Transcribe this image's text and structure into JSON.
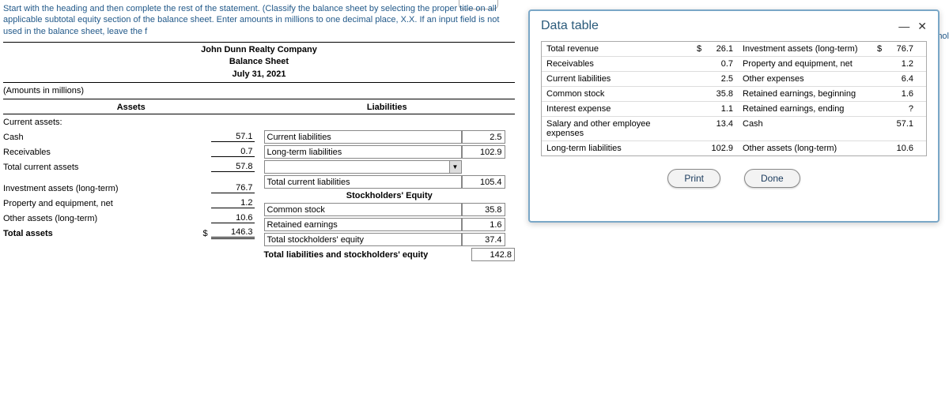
{
  "instructions": "Start with the heading and then complete the rest of the statement. (Classify the balance sheet by selecting the proper title on all applicable subtotal equity section of the balance sheet. Enter amounts in millions to one decimal place, X.X. If an input field is not used in the balance sheet, leave the f",
  "right_fragment": "tockhol",
  "header": {
    "company": "John Dunn Realty Company",
    "stmt": "Balance Sheet",
    "date": "July 31, 2021"
  },
  "amounts_note": "(Amounts in millions)",
  "col_headers": {
    "left": "Assets",
    "right": "Liabilities"
  },
  "assets": {
    "current_label": "Current assets:",
    "cash": {
      "label": "Cash",
      "amt": "57.1"
    },
    "recv": {
      "label": "Receivables",
      "amt": "0.7"
    },
    "tca": {
      "label": "Total current assets",
      "amt": "57.8"
    },
    "inv": {
      "label": "Investment assets (long-term)",
      "amt": "76.7"
    },
    "ppe": {
      "label": "Property and equipment, net",
      "amt": "1.2"
    },
    "other": {
      "label": "Other assets (long-term)",
      "amt": "10.6"
    },
    "total": {
      "label": "Total assets",
      "cur": "$",
      "amt": "146.3"
    }
  },
  "liab": {
    "cl": {
      "label": "Current liabilities",
      "amt": "2.5"
    },
    "lt": {
      "label": "Long-term liabilities",
      "amt": "102.9"
    },
    "blank": {
      "label": "",
      "amt": ""
    },
    "tcl": {
      "label": "Total current liabilities",
      "amt": "105.4"
    },
    "se_header": "Stockholders' Equity",
    "cs": {
      "label": "Common stock",
      "amt": "35.8"
    },
    "re": {
      "label": "Retained earnings",
      "amt": "1.6"
    },
    "tse": {
      "label": "Total stockholders' equity",
      "amt": "37.4"
    },
    "tlse": {
      "label": "Total liabilities and stockholders' equity",
      "amt": "142.8"
    }
  },
  "modal": {
    "title": "Data table",
    "rows": [
      {
        "l": "Total revenue",
        "lc": "$",
        "lv": "26.1",
        "r": "Investment assets (long-term)",
        "rc": "$",
        "rv": "76.7"
      },
      {
        "l": "Receivables",
        "lc": "",
        "lv": "0.7",
        "r": "Property and equipment, net",
        "rc": "",
        "rv": "1.2"
      },
      {
        "l": "Current liabilities",
        "lc": "",
        "lv": "2.5",
        "r": "Other expenses",
        "rc": "",
        "rv": "6.4"
      },
      {
        "l": "Common stock",
        "lc": "",
        "lv": "35.8",
        "r": "Retained earnings, beginning",
        "rc": "",
        "rv": "1.6"
      },
      {
        "l": "Interest expense",
        "lc": "",
        "lv": "1.1",
        "r": "Retained earnings, ending",
        "rc": "",
        "rv": "?"
      },
      {
        "l": "Salary and other employee expenses",
        "lc": "",
        "lv": "13.4",
        "r": "Cash",
        "rc": "",
        "rv": "57.1"
      },
      {
        "l": "Long-term liabilities",
        "lc": "",
        "lv": "102.9",
        "r": "Other assets (long-term)",
        "rc": "",
        "rv": "10.6"
      }
    ],
    "print": "Print",
    "done": "Done"
  }
}
